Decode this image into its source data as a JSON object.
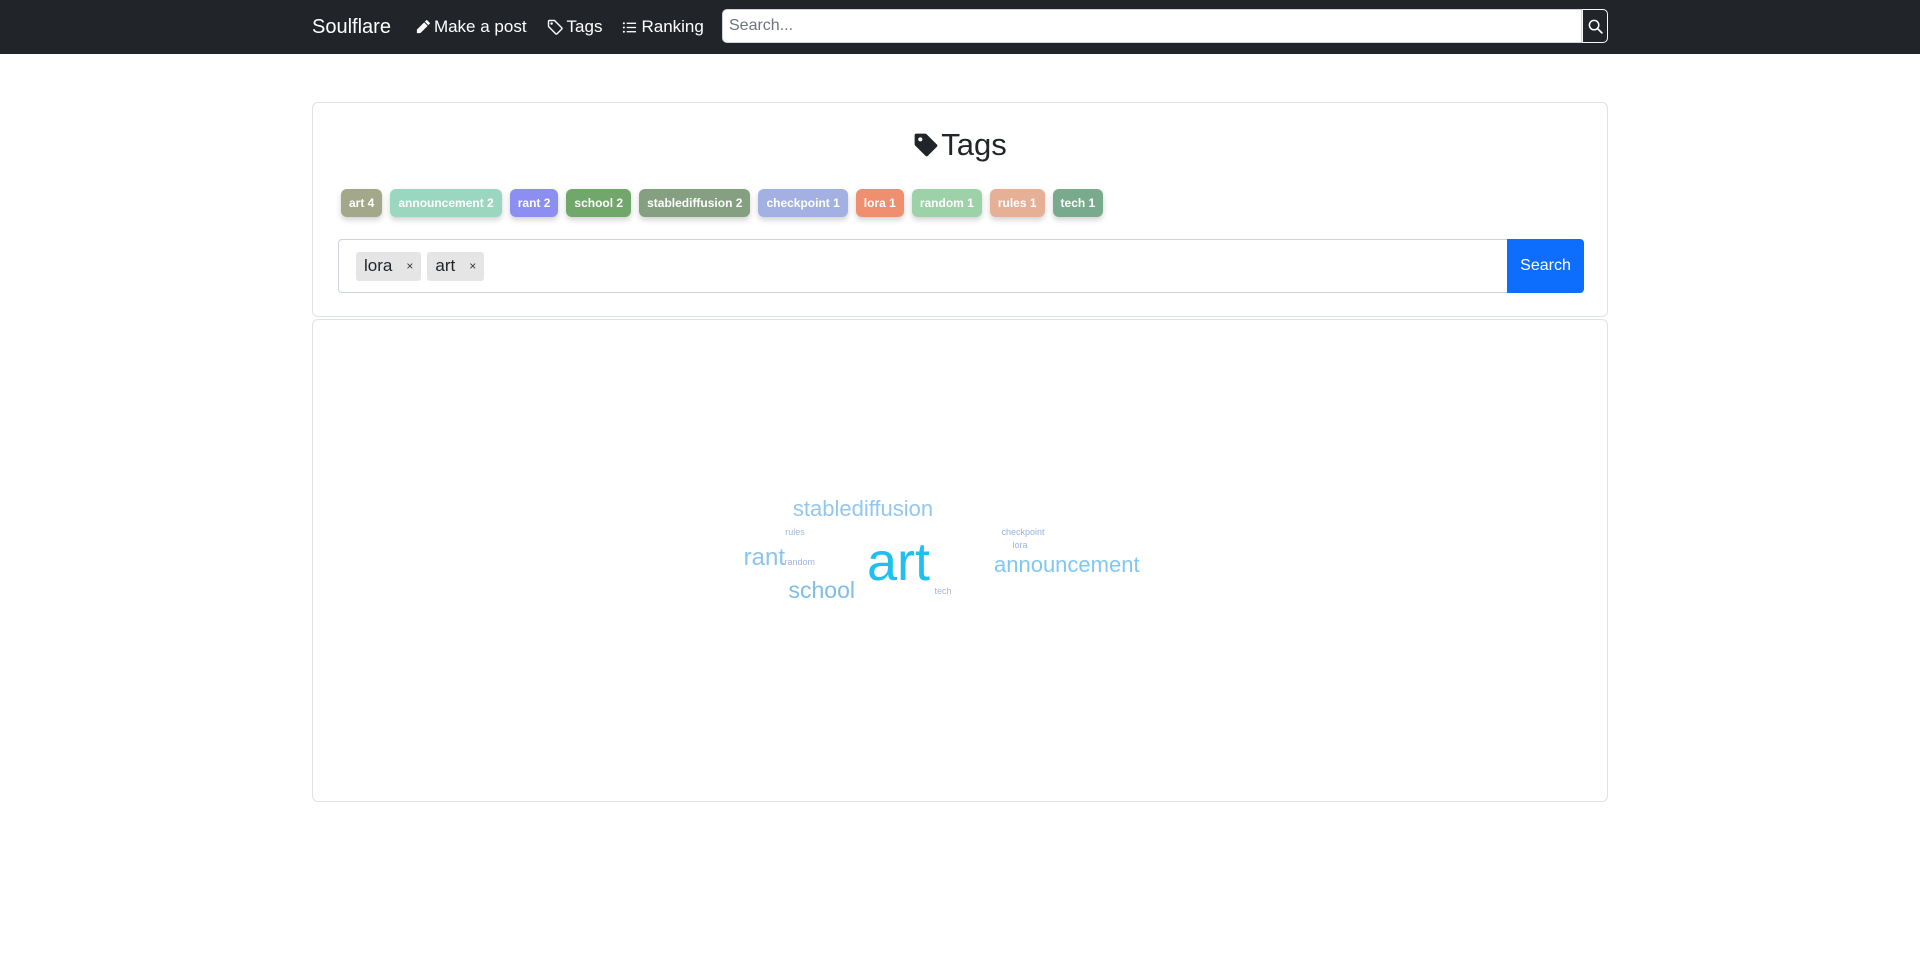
{
  "navbar": {
    "brand": "Soulflare",
    "links": [
      {
        "label": "Make a post",
        "icon": "pencil-icon"
      },
      {
        "label": "Tags",
        "icon": "tag-icon"
      },
      {
        "label": "Ranking",
        "icon": "list-icon"
      }
    ],
    "search_placeholder": "Search...",
    "search_icon": "search-icon"
  },
  "tags_panel": {
    "title": "Tags",
    "title_icon": "tag-icon",
    "badges": [
      {
        "label": "art 4",
        "color": "#a3a88a"
      },
      {
        "label": "announcement 2",
        "color": "#9bd6c0"
      },
      {
        "label": "rant 2",
        "color": "#8c8ef2"
      },
      {
        "label": "school 2",
        "color": "#72a76b"
      },
      {
        "label": "stablediffusion 2",
        "color": "#85a080"
      },
      {
        "label": "checkpoint 1",
        "color": "#a2b0e2"
      },
      {
        "label": "lora 1",
        "color": "#f08f6f"
      },
      {
        "label": "random 1",
        "color": "#9dd1a8"
      },
      {
        "label": "rules 1",
        "color": "#e6b096"
      },
      {
        "label": "tech 1",
        "color": "#7aaa8d"
      }
    ],
    "selected_tags": [
      {
        "label": "lora",
        "remove": "×"
      },
      {
        "label": "art",
        "remove": "×"
      }
    ],
    "search_button": "Search"
  },
  "word_cloud": {
    "words": [
      {
        "text": "stablediffusion",
        "weight": 2,
        "color": "#93c7ee"
      },
      {
        "text": "rules",
        "weight": 1,
        "color": "#a3b8da"
      },
      {
        "text": "checkpoint",
        "weight": 1,
        "color": "#93b0dc"
      },
      {
        "text": "lora",
        "weight": 1,
        "color": "#9cb4e4"
      },
      {
        "text": "rant",
        "weight": 2,
        "color": "#8cc4ec"
      },
      {
        "text": "art",
        "weight": 4,
        "color": "#1fc0f1"
      },
      {
        "text": "announcement",
        "weight": 2,
        "color": "#80c8f2"
      },
      {
        "text": "random",
        "weight": 1,
        "color": "#a0b4e0"
      },
      {
        "text": "school",
        "weight": 2,
        "color": "#7ebde8"
      },
      {
        "text": "tech",
        "weight": 1,
        "color": "#a6b2e4"
      }
    ]
  }
}
